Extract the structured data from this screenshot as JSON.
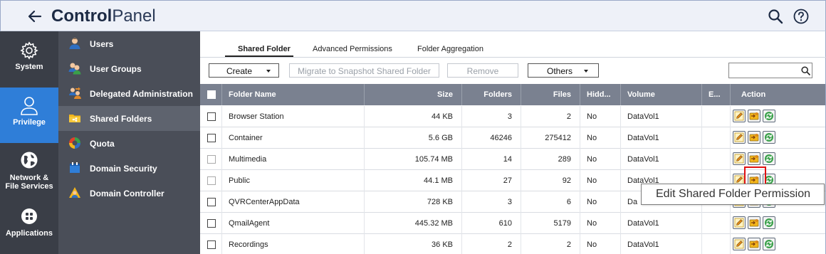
{
  "header": {
    "title_bold": "Control",
    "title_light": "Panel"
  },
  "leftnav": [
    {
      "label": "System",
      "icon": "gear-icon"
    },
    {
      "label": "Privilege",
      "icon": "user-icon",
      "active": true
    },
    {
      "label_line1": "Network &",
      "label_line2": "File Services",
      "icon": "globe-icon"
    },
    {
      "label": "Applications",
      "icon": "apps-grid-icon"
    }
  ],
  "submenu": [
    {
      "label": "Users",
      "icon": "user-icon"
    },
    {
      "label": "User Groups",
      "icon": "user-group-icon"
    },
    {
      "label": "Delegated Administration",
      "icon": "delegated-admin-icon"
    },
    {
      "label": "Shared Folders",
      "icon": "folder-icon",
      "active": true
    },
    {
      "label": "Quota",
      "icon": "quota-pie-icon"
    },
    {
      "label": "Domain Security",
      "icon": "domain-security-icon"
    },
    {
      "label": "Domain Controller",
      "icon": "domain-controller-icon"
    }
  ],
  "tabs": [
    {
      "label": "Shared Folder",
      "active": true
    },
    {
      "label": "Advanced Permissions"
    },
    {
      "label": "Folder Aggregation"
    }
  ],
  "toolbar": {
    "create": "Create",
    "migrate": "Migrate to Snapshot Shared Folder",
    "remove": "Remove",
    "others": "Others",
    "search_value": ""
  },
  "table": {
    "columns": [
      "Folder Name",
      "Size",
      "Folders",
      "Files",
      "Hidd...",
      "Volume",
      "E...",
      "Action"
    ],
    "rows": [
      {
        "name": "Browser Station",
        "size": "44 KB",
        "folders": "3",
        "files": "2",
        "hidden": "No",
        "volume": "DataVol1"
      },
      {
        "name": "Container",
        "size": "5.6 GB",
        "folders": "46246",
        "files": "275412",
        "hidden": "No",
        "volume": "DataVol1"
      },
      {
        "name": "Multimedia",
        "size": "105.74 MB",
        "folders": "14",
        "files": "289",
        "hidden": "No",
        "volume": "DataVol1"
      },
      {
        "name": "Public",
        "size": "44.1 MB",
        "folders": "27",
        "files": "92",
        "hidden": "No",
        "volume": "DataVol1"
      },
      {
        "name": "QVRCenterAppData",
        "size": "728 KB",
        "folders": "3",
        "files": "6",
        "hidden": "No",
        "volume": "Da"
      },
      {
        "name": "QmailAgent",
        "size": "445.32 MB",
        "folders": "610",
        "files": "5179",
        "hidden": "No",
        "volume": "DataVol1"
      },
      {
        "name": "Recordings",
        "size": "36 KB",
        "folders": "2",
        "files": "2",
        "hidden": "No",
        "volume": "DataVol1"
      }
    ]
  },
  "tooltip": "Edit Shared Folder Permission",
  "colors": {
    "accent": "#2f7ed8",
    "leftnav": "#3a3e47",
    "submenu": "#4a4e58",
    "table_header": "#7a8190",
    "highlight": "#e01010"
  }
}
